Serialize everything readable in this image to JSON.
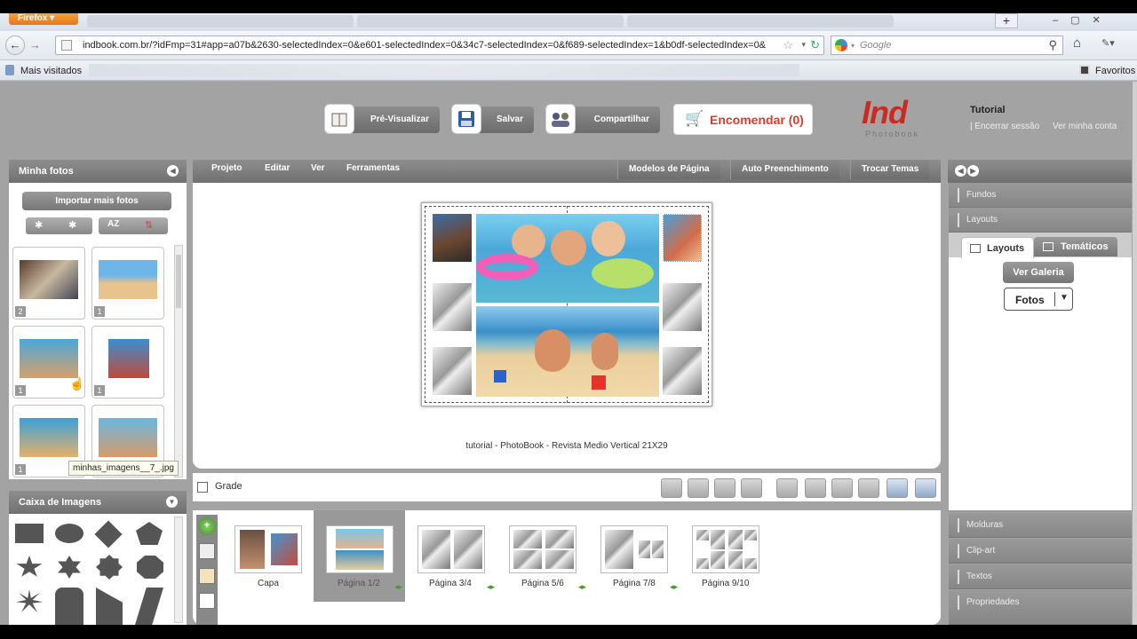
{
  "browser": {
    "app_button": "Firefox",
    "url": "indbook.com.br/?idFmp=31#app=a07b&2630-selectedIndex=0&e601-selectedIndex=0&34c7-selectedIndex=0&f689-selectedIndex=1&b0df-selectedIndex=0&",
    "search_placeholder": "Google",
    "bookmarks": {
      "most_visited": "Mais visitados",
      "favorites": "Favoritos"
    }
  },
  "app": {
    "toolbar": {
      "preview": "Pré-Visualizar",
      "save": "Salvar",
      "share": "Compartilhar",
      "order": "Encomendar (0)"
    },
    "logo": {
      "brand": "Ind",
      "subtitle": "Photobook"
    },
    "user": {
      "name": "Tutorial",
      "logout": "| Encerrar sessão",
      "account": "Ver minha conta"
    },
    "left": {
      "header": "Minha fotos",
      "import": "Importar mais fotos",
      "photos": [
        {
          "count": "2"
        },
        {
          "count": "1"
        },
        {
          "count": "1"
        },
        {
          "count": "1"
        },
        {
          "count": "1"
        }
      ],
      "tooltip": "minhas_imagens__7_.jpg",
      "shapes_header": "Caixa de Imagens"
    },
    "menu": [
      "Projeto",
      "Editar",
      "Ver",
      "Ferramentas"
    ],
    "menu_buttons": [
      "Modelos de Página",
      "Auto Preenchimento",
      "Trocar Temas"
    ],
    "canvas": {
      "caption": "tutorial - PhotoBook - Revista Medio Vertical 21X29",
      "grid": "Grade"
    },
    "pages": [
      "Capa",
      "Página 1/2",
      "Página 3/4",
      "Página 5/6",
      "Página 7/8",
      "Página 9/10"
    ],
    "right": {
      "sections": [
        "Fundos",
        "Layouts",
        "Molduras",
        "Clip-art",
        "Textos",
        "Propriedades"
      ],
      "tabs": [
        "Layouts",
        "Temáticos"
      ],
      "gallery": "Ver Galeria",
      "select_value": "Fotos"
    }
  }
}
